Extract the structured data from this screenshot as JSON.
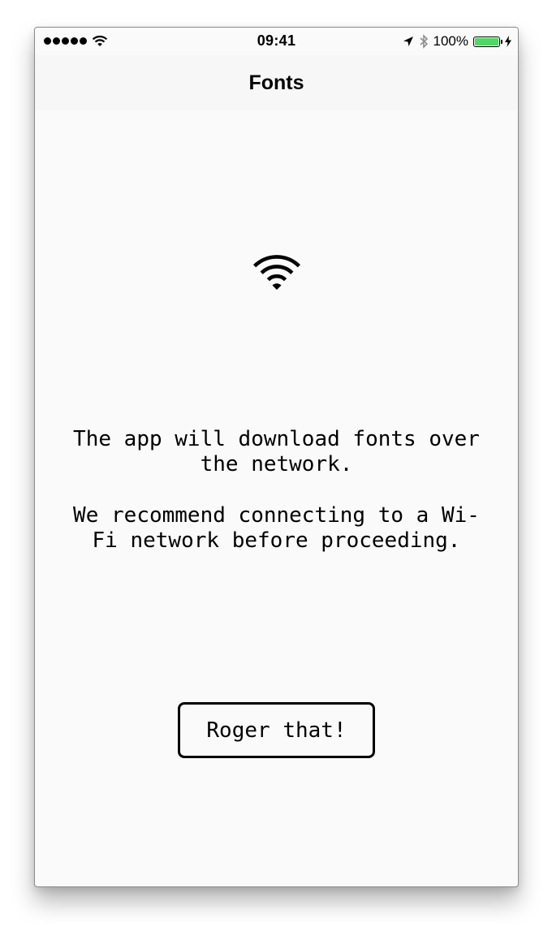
{
  "status_bar": {
    "time": "09:41",
    "battery_percent": "100%",
    "battery_level": 1.0,
    "battery_color": "#4cd964",
    "signal_bars": 5,
    "icons": [
      "signal-dots-icon",
      "wifi-icon",
      "location-arrow-icon",
      "bluetooth-icon",
      "battery-icon",
      "charging-bolt-icon"
    ]
  },
  "nav": {
    "title": "Fonts"
  },
  "main": {
    "icon": "wifi-icon",
    "message_1": "The app will download fonts over the network.",
    "message_2": "We recommend connecting to a Wi-Fi network before proceeding.",
    "button_label": "Roger that!"
  }
}
